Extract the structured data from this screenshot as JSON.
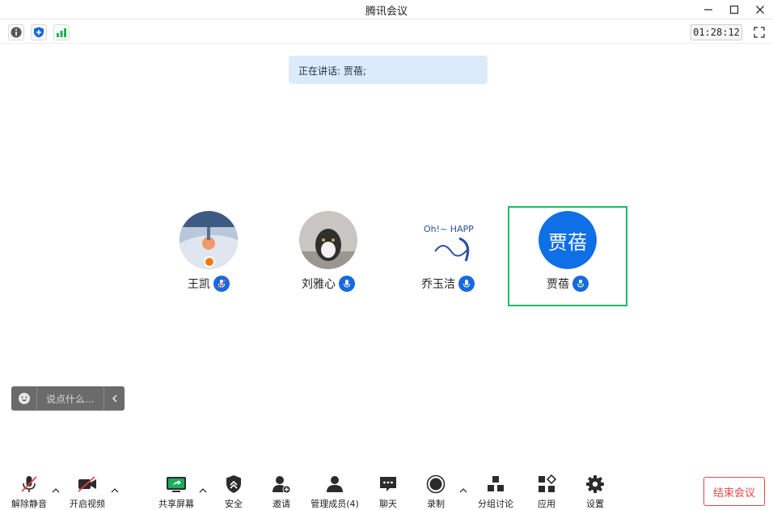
{
  "window": {
    "title": "腾讯会议"
  },
  "infobar": {
    "timer": "01:28:12"
  },
  "speaking": {
    "label": "正在讲话: 贾蓓;"
  },
  "participants": [
    {
      "name": "王凯",
      "mic": "muted-host"
    },
    {
      "name": "刘雅心",
      "mic": "on"
    },
    {
      "name": "乔玉洁",
      "mic": "on"
    },
    {
      "name": "贾蓓",
      "mic": "speaking",
      "avatar_text": "贾蓓"
    }
  ],
  "avatar_art": {
    "qiao_text": "Oh!~ HAPPY!"
  },
  "chat": {
    "placeholder": "说点什么..."
  },
  "toolbar": {
    "unmute": "解除静音",
    "video": "开启视频",
    "share": "共享屏幕",
    "security": "安全",
    "invite": "邀请",
    "members": "管理成员(4)",
    "chat": "聊天",
    "record": "录制",
    "breakout": "分组讨论",
    "apps": "应用",
    "settings": "设置",
    "end": "结束会议"
  },
  "colors": {
    "accent": "#1769e0",
    "active_border": "#1fbb6a",
    "end": "#e84545"
  }
}
